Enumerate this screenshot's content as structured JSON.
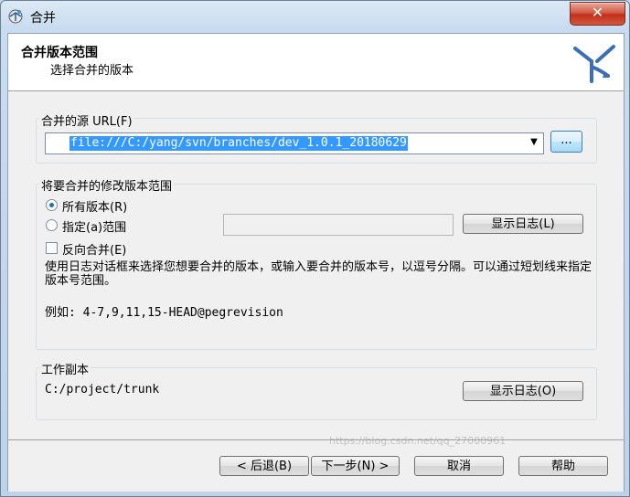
{
  "window": {
    "title": "合并",
    "close_label": "✕"
  },
  "header": {
    "title": "合并版本范围",
    "subtitle": "选择合并的版本"
  },
  "source": {
    "group_label": "合并的源 URL(F)",
    "url_value": "file:///C:/yang/svn/branches/dev_1.0.1_20180629",
    "browse_label": "..."
  },
  "revision_range": {
    "group_label": "将要合并的修改版本范围",
    "all_revisions_label": "所有版本(R)",
    "specific_range_label": "指定(a)范围",
    "show_log_label": "显示日志(L)",
    "reverse_merge_label": "反向合并(E)",
    "description": "使用日志对话框来选择您想要合并的版本，或输入要合并的版本号，以逗号分隔。可以通过短划线来指定版本号范围。",
    "example": "例如: 4-7,9,11,15-HEAD@pegrevision",
    "range_value": ""
  },
  "working_copy": {
    "group_label": "工作副本",
    "path": "C:/project/trunk",
    "show_log_label": "显示日志(O)"
  },
  "footer": {
    "back_label": "< 后退(B)",
    "next_label": "下一步(N) >",
    "cancel_label": "取消",
    "help_label": "帮助"
  },
  "watermark": "https://blog.csdn.net/qq_27000961"
}
